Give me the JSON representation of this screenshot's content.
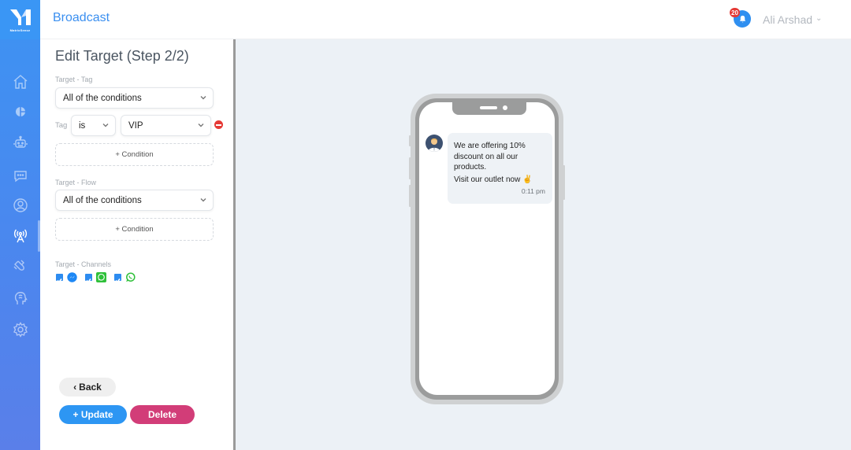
{
  "brand": {
    "name": "MatrixSense"
  },
  "header": {
    "title": "Broadcast",
    "notification_count": "20",
    "user_name": "Ali Arshad"
  },
  "sidebar": {
    "items": [
      {
        "name": "home",
        "active": false
      },
      {
        "name": "analytics",
        "active": false
      },
      {
        "name": "bot",
        "active": false
      },
      {
        "name": "chat",
        "active": false
      },
      {
        "name": "users",
        "active": false
      },
      {
        "name": "broadcast",
        "active": true
      },
      {
        "name": "magnet",
        "active": false
      },
      {
        "name": "ai-brain",
        "active": false
      },
      {
        "name": "settings",
        "active": false
      }
    ]
  },
  "form": {
    "title": "Edit Target (Step 2/2)",
    "target_tag": {
      "label": "Target - Tag",
      "match": "All of the conditions",
      "condition": {
        "field_label": "Tag",
        "operator": "is",
        "value": "VIP"
      },
      "add_condition": "+ Condition"
    },
    "target_flow": {
      "label": "Target - Flow",
      "match": "All of the conditions",
      "add_condition": "+ Condition"
    },
    "target_channels": {
      "label": "Target - Channels",
      "channels": [
        {
          "name": "Messenger",
          "checked": true,
          "color": "#1e88f5"
        },
        {
          "name": "WhatsApp Business",
          "checked": true,
          "color": "#2fc03a"
        },
        {
          "name": "WhatsApp",
          "checked": true,
          "color": "#2fc03a"
        }
      ]
    },
    "buttons": {
      "back": "Back",
      "update": "+ Update",
      "delete": "Delete"
    }
  },
  "preview": {
    "message_lines": [
      "We are offering 10%",
      "discount on all our",
      "products."
    ],
    "message_cta": "Visit our outlet now ✌",
    "time": "0:11 pm"
  },
  "colors": {
    "accent": "#2f8ff0",
    "update": "#2d96f3",
    "delete": "#d23d78",
    "back": "#efefef"
  }
}
